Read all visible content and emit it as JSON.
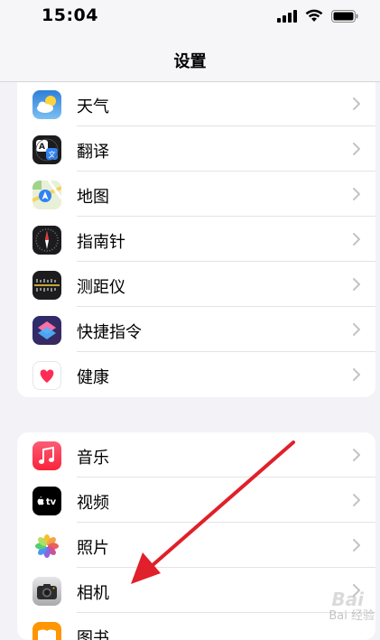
{
  "status": {
    "time": "15:04"
  },
  "nav": {
    "title": "设置"
  },
  "group1": [
    {
      "label": "天气",
      "icon": "weather-icon"
    },
    {
      "label": "翻译",
      "icon": "translate-icon"
    },
    {
      "label": "地图",
      "icon": "maps-icon"
    },
    {
      "label": "指南针",
      "icon": "compass-icon"
    },
    {
      "label": "测距仪",
      "icon": "measure-icon"
    },
    {
      "label": "快捷指令",
      "icon": "shortcuts-icon"
    },
    {
      "label": "健康",
      "icon": "health-icon"
    }
  ],
  "group2": [
    {
      "label": "音乐",
      "icon": "music-icon"
    },
    {
      "label": "视频",
      "icon": "tv-icon"
    },
    {
      "label": "照片",
      "icon": "photos-icon"
    },
    {
      "label": "相机",
      "icon": "camera-icon"
    },
    {
      "label": "图书",
      "icon": "books-icon"
    }
  ],
  "watermark": "Bai 经验",
  "colors": {
    "arrow": "#e0202a",
    "chevron": "#c4c4c7"
  }
}
